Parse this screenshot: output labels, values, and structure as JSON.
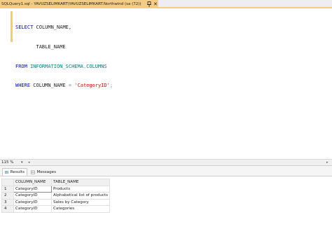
{
  "document_tab": {
    "title": "SQLQuery1.sql - YAVUZSELIMKART\\YAVUZSELIMKART.Northwind (sa (72))",
    "close_glyph": "✕"
  },
  "editor": {
    "line1": {
      "kw": "SELECT",
      "rest": " COLUMN_NAME,"
    },
    "line2": {
      "rest": "       TABLE_NAME"
    },
    "line3": {
      "kw": "FROM",
      "obj": "INFORMATION_SCHEMA",
      "dot": ".",
      "view": "COLUMNS"
    },
    "line4": {
      "kw": "WHERE",
      "col": "COLUMN_NAME",
      "op": " = ",
      "str": "'CategoryID'",
      "semi": ";"
    }
  },
  "zoom": {
    "value": "115 %",
    "dropdown_glyph": "▾",
    "left_glyph": "◂",
    "right_glyph": "▸"
  },
  "results_tabs": [
    {
      "label": "Results"
    },
    {
      "label": "Messages"
    }
  ],
  "grid": {
    "columns": [
      "COLUMN_NAME",
      "TABLE_NAME"
    ],
    "rows": [
      {
        "n": "1",
        "column_name": "CategoryID",
        "table_name": "Products"
      },
      {
        "n": "2",
        "column_name": "CategoryID",
        "table_name": "Alphabetical list of products"
      },
      {
        "n": "3",
        "column_name": "CategoryID",
        "table_name": "Sales by Category"
      },
      {
        "n": "4",
        "column_name": "CategoryID",
        "table_name": "Categories"
      }
    ]
  },
  "colors": {
    "tab_accent": "#f5cc84",
    "keyword": "#0000ff",
    "string": "#ff0000",
    "schema_object": "#008080"
  }
}
